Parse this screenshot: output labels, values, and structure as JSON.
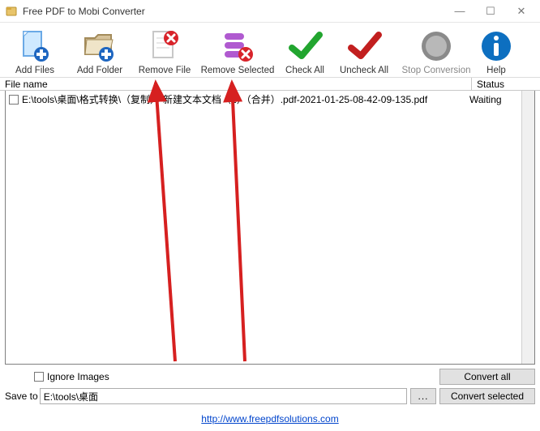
{
  "window": {
    "title": "Free PDF to Mobi Converter"
  },
  "toolbar": {
    "add_files": "Add Files",
    "add_folder": "Add Folder",
    "remove_file": "Remove File",
    "remove_selected": "Remove Selected",
    "check_all": "Check All",
    "uncheck_all": "Uncheck All",
    "stop_conversion": "Stop Conversion",
    "help": "Help"
  },
  "columns": {
    "file_name": "File name",
    "status": "Status"
  },
  "files": [
    {
      "name": "E:\\tools\\桌面\\格式转换\\（复制）-新建文本文档（2）（合并）.pdf-2021-01-25-08-42-09-135.pdf",
      "status": "Waiting"
    }
  ],
  "bottom": {
    "ignore_images": "Ignore Images",
    "save_to_label": "Save to",
    "save_to_value": "E:\\tools\\桌面",
    "browse": "...",
    "convert_all": "Convert all",
    "convert_selected": "Convert selected"
  },
  "footer": {
    "url": "http://www.freepdfsolutions.com"
  }
}
